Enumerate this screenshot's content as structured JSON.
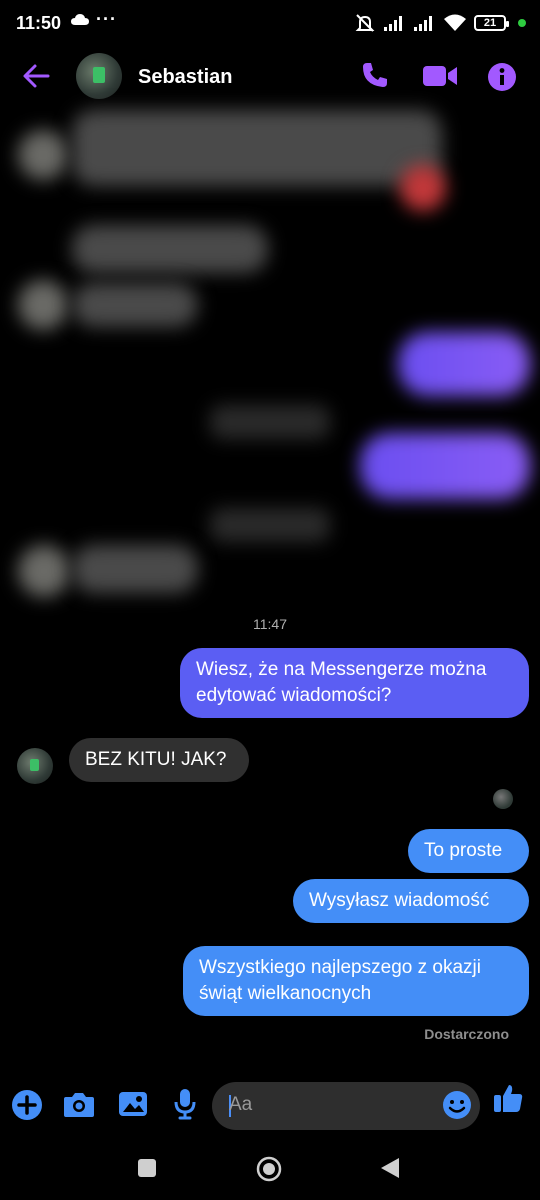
{
  "status_bar": {
    "time": "11:50",
    "battery": "21"
  },
  "header": {
    "contact_name": "Sebastian"
  },
  "conversation": {
    "timestamp": "11:47",
    "messages": [
      {
        "sender": "me",
        "text": "Wiesz, że na Messengerze można edytować wiadomości?"
      },
      {
        "sender": "contact",
        "text": "BEZ KITU! JAK?"
      },
      {
        "sender": "me",
        "text": "To proste"
      },
      {
        "sender": "me",
        "text": "Wysyłasz wiadomość"
      },
      {
        "sender": "me",
        "text": "Wszystkiego najlepszego z okazji świąt wielkanocnych"
      }
    ],
    "delivery_status": "Dostarczono"
  },
  "composer": {
    "placeholder": "Aa"
  },
  "icons": {
    "status": [
      "cloud-icon",
      "more-dots-icon",
      "mute-icon",
      "signal-icon",
      "wifi-icon",
      "battery-icon"
    ],
    "header": [
      "back-arrow-icon",
      "phone-icon",
      "video-icon",
      "info-icon"
    ],
    "composer": [
      "plus-icon",
      "camera-icon",
      "gallery-icon",
      "microphone-icon",
      "emoji-icon",
      "thumbs-up-icon"
    ],
    "navigation": [
      "recents-icon",
      "home-icon",
      "back-icon"
    ]
  },
  "colors": {
    "accent_purple": "#a259ff",
    "accent_blue": "#448ef7",
    "bubble_me_top": "#5b5ef3",
    "bubble_contact": "#303030",
    "background": "#000000"
  }
}
